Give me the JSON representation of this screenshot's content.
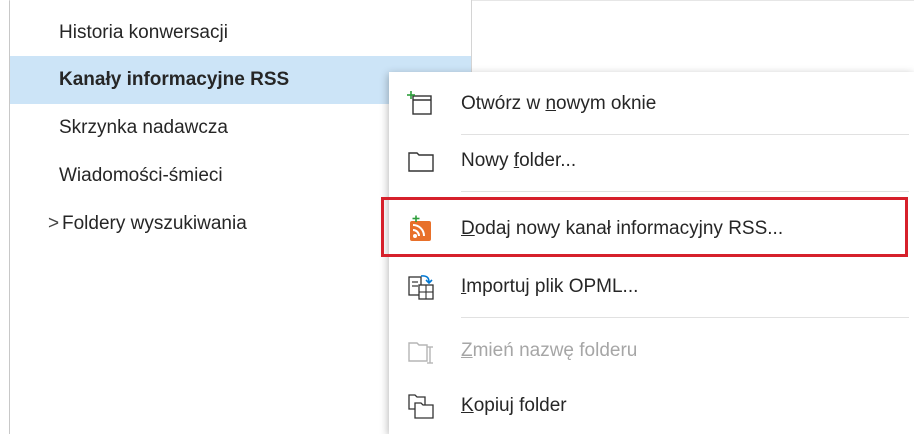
{
  "folders": [
    {
      "label": "Historia konwersacji"
    },
    {
      "label": "Kanały informacyjne RSS"
    },
    {
      "label": "Skrzynka nadawcza"
    },
    {
      "label": "Wiadomości-śmieci"
    },
    {
      "label": "Foldery wyszukiwania",
      "chevron": ">"
    }
  ],
  "menu": {
    "open_new_window": {
      "pre": "Otwórz w ",
      "key": "n",
      "post": "owym oknie",
      "icon": "open-new-window-icon"
    },
    "new_folder": {
      "pre": "Nowy ",
      "key": "f",
      "post": "older...",
      "icon": "folder-icon"
    },
    "add_rss": {
      "pre": "",
      "key": "D",
      "post": "odaj nowy kanał informacyjny RSS...",
      "icon": "rss-add-icon"
    },
    "import_opml": {
      "pre": "",
      "key": "I",
      "post": "mportuj plik OPML...",
      "icon": "import-opml-icon"
    },
    "rename_folder": {
      "pre": "",
      "key": "Z",
      "post": "mień nazwę folderu",
      "icon": "rename-folder-icon",
      "disabled": true
    },
    "copy_folder": {
      "pre": "",
      "key": "K",
      "post": "opiuj folder",
      "icon": "copy-folder-icon"
    }
  },
  "colors": {
    "selection": "#cce4f7",
    "highlight_border": "#d6202b",
    "rss_orange": "#e8702a",
    "outlook_blue": "#0078d4"
  }
}
